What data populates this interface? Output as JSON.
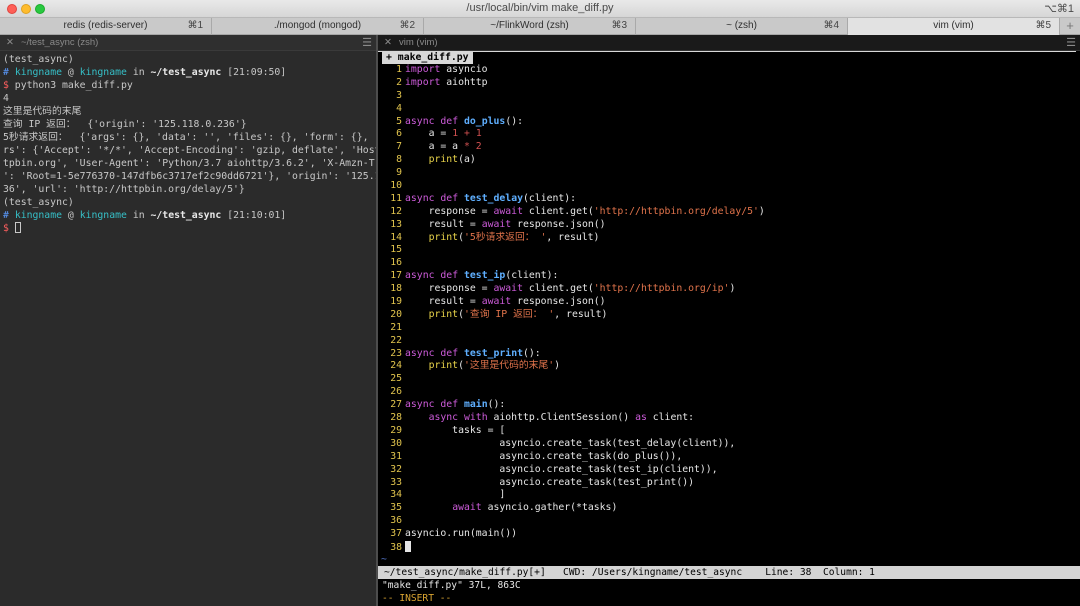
{
  "window": {
    "title": "/usr/local/bin/vim make_diff.py",
    "corner_shortcut": "⌥⌘1"
  },
  "tabs": [
    {
      "label": "redis (redis-server)",
      "shortcut": "⌘1"
    },
    {
      "label": "./mongod (mongod)",
      "shortcut": "⌘2"
    },
    {
      "label": "~/FlinkWord (zsh)",
      "shortcut": "⌘3"
    },
    {
      "label": "~ (zsh)",
      "shortcut": "⌘4"
    },
    {
      "label": "vim (vim)",
      "shortcut": "⌘5"
    }
  ],
  "new_tab_label": "+",
  "left_pane": {
    "close_glyph": "✕",
    "title": "~/test_async (zsh)",
    "menu_glyph": "☰",
    "lines": [
      "(test_async)",
      "__PROMPT1__",
      "__CMD__",
      "4",
      "这里是代码的末尾",
      "查询 IP 返回：  {'origin': '125.118.0.236'}",
      "5秒请求返回：  {'args': {}, 'data': '', 'files': {}, 'form': {}, 'heade",
      "rs': {'Accept': '*/*', 'Accept-Encoding': 'gzip, deflate', 'Host': 'ht",
      "tpbin.org', 'User-Agent': 'Python/3.7 aiohttp/3.6.2', 'X-Amzn-Trace-Id",
      "': 'Root=1-5e776370-147dfb6c3717ef2c90dd6721'}, 'origin': '125.118.0.2",
      "36', 'url': 'http://httpbin.org/delay/5'}",
      "(test_async)",
      "__PROMPT2__",
      "__CURSOR__"
    ],
    "prompt1": {
      "hash": "#",
      "user": "kingname",
      "at": "@",
      "host": "kingname",
      "in": "in",
      "path": "~/test_async",
      "time": "[21:09:50]"
    },
    "command": {
      "dollar": "$",
      "text": "python3 make_diff.py"
    },
    "prompt2": {
      "hash": "#",
      "user": "kingname",
      "at": "@",
      "host": "kingname",
      "in": "in",
      "path": "~/test_async",
      "time": "[21:10:01]"
    },
    "cursor_dollar": "$"
  },
  "right_pane": {
    "close_glyph": "✕",
    "title": "vim (vim)",
    "menu_glyph": "☰",
    "buffer_tab": "+ make_diff.py",
    "tilde": "~",
    "statusline": "~/test_async/make_diff.py[+]   CWD: /Users/kingname/test_async    Line: 38  Column: 1",
    "message": "\"make_diff.py\" 37L, 863C",
    "mode": "-- INSERT --"
  }
}
